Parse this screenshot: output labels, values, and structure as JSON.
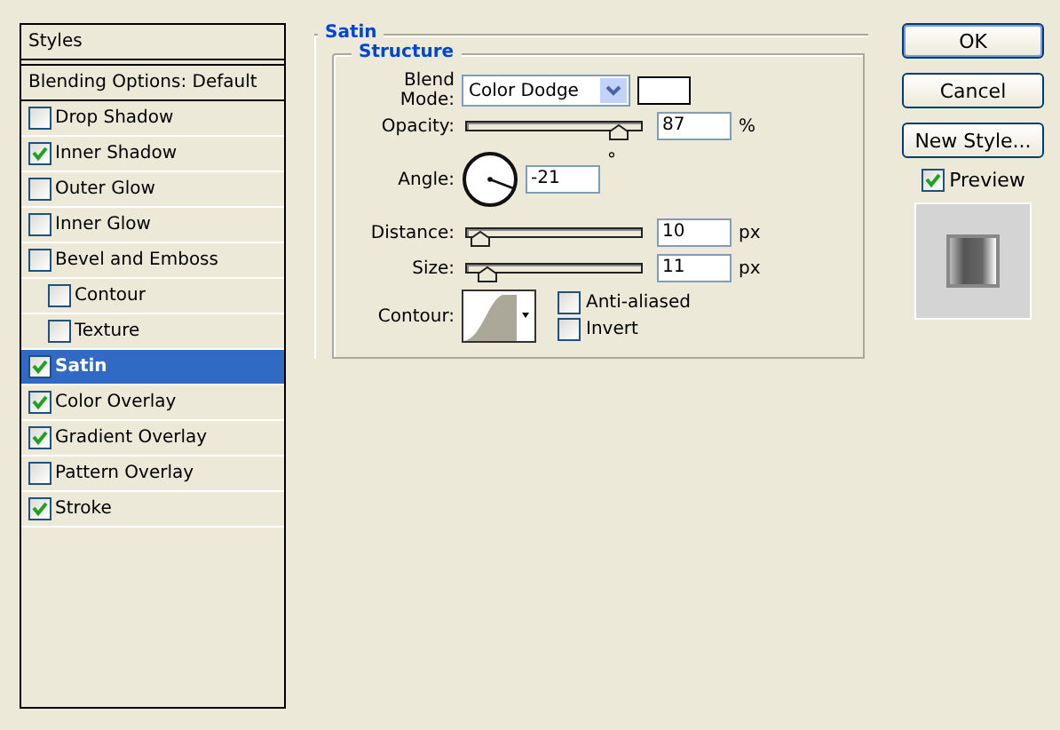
{
  "styles_panel": {
    "title": "Styles",
    "blending_options": "Blending Options: Default",
    "items": [
      {
        "label": "Drop Shadow",
        "checked": false,
        "selected": false
      },
      {
        "label": "Inner Shadow",
        "checked": true,
        "selected": false
      },
      {
        "label": "Outer Glow",
        "checked": false,
        "selected": false
      },
      {
        "label": "Inner Glow",
        "checked": false,
        "selected": false
      },
      {
        "label": "Bevel and Emboss",
        "checked": false,
        "selected": false,
        "children": [
          {
            "label": "Contour",
            "checked": false,
            "selected": false
          },
          {
            "label": "Texture",
            "checked": false,
            "selected": false
          }
        ]
      },
      {
        "label": "Satin",
        "checked": true,
        "selected": true
      },
      {
        "label": "Color Overlay",
        "checked": true,
        "selected": false
      },
      {
        "label": "Gradient Overlay",
        "checked": true,
        "selected": false
      },
      {
        "label": "Pattern Overlay",
        "checked": false,
        "selected": false
      },
      {
        "label": "Stroke",
        "checked": true,
        "selected": false
      }
    ]
  },
  "satin": {
    "title": "Satin",
    "structure": {
      "title": "Structure",
      "blend_mode": {
        "label": "Blend Mode:",
        "value": "Color Dodge"
      },
      "opacity": {
        "label": "Opacity:",
        "value": "87",
        "unit": "%",
        "level": 0.87
      },
      "angle": {
        "label": "Angle:",
        "value": "-21",
        "unit": "°"
      },
      "sliders": [
        {
          "label": "Distance:",
          "value": "10",
          "unit": "px",
          "level": 0.07
        },
        {
          "label": "Size:",
          "value": "11",
          "unit": "px",
          "level": 0.11
        }
      ],
      "contour": {
        "label": "Contour:"
      },
      "options": [
        {
          "label": "Anti-aliased",
          "checked": false
        },
        {
          "label": "Invert",
          "checked": false
        }
      ]
    }
  },
  "buttons": [
    "OK",
    "Cancel",
    "New Style..."
  ],
  "preview": {
    "label": "Preview",
    "checked": true
  }
}
